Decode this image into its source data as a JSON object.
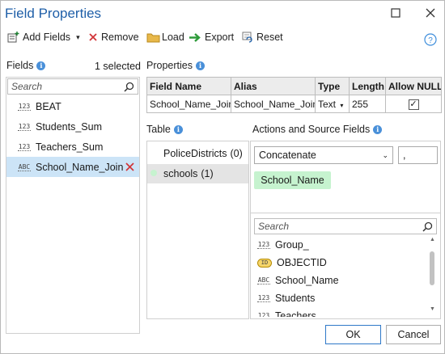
{
  "window": {
    "title": "Field Properties"
  },
  "toolbar": {
    "add_fields": "Add Fields",
    "remove": "Remove",
    "load": "Load",
    "export": "Export",
    "reset": "Reset"
  },
  "fields_panel": {
    "label": "Fields",
    "selected_count": "1 selected",
    "search_placeholder": "Search",
    "items": [
      {
        "type": "123",
        "name": "BEAT"
      },
      {
        "type": "123",
        "name": "Students_Sum"
      },
      {
        "type": "123",
        "name": "Teachers_Sum"
      },
      {
        "type": "ABC",
        "name": "School_Name_Join"
      }
    ]
  },
  "properties": {
    "label": "Properties",
    "headers": [
      "Field Name",
      "Alias",
      "Type",
      "Length",
      "Allow NULL"
    ],
    "row": {
      "field_name": "School_Name_Join",
      "alias": "School_Name_Join",
      "type": "Text",
      "length": "255",
      "allow_null": true
    }
  },
  "table_panel": {
    "label": "Table",
    "items": [
      {
        "name": "PoliceDistricts",
        "count": "(0)"
      },
      {
        "name": "schools",
        "count": "(1)"
      }
    ]
  },
  "actions_panel": {
    "label": "Actions and Source Fields",
    "action": "Concatenate",
    "delimiter": ",",
    "chip": "School_Name",
    "search_placeholder": "Search",
    "source_fields": [
      {
        "type": "123",
        "name": "Group_"
      },
      {
        "type": "ID",
        "name": "OBJECTID"
      },
      {
        "type": "ABC",
        "name": "School_Name"
      },
      {
        "type": "123",
        "name": "Students"
      },
      {
        "type": "123",
        "name": "Teachers"
      }
    ]
  },
  "footer": {
    "ok": "OK",
    "cancel": "Cancel"
  },
  "colors": {
    "accent": "#1f5fa8",
    "selection": "#cce4f7",
    "chip": "#c6f3cf",
    "remove_red": "#d13438"
  }
}
